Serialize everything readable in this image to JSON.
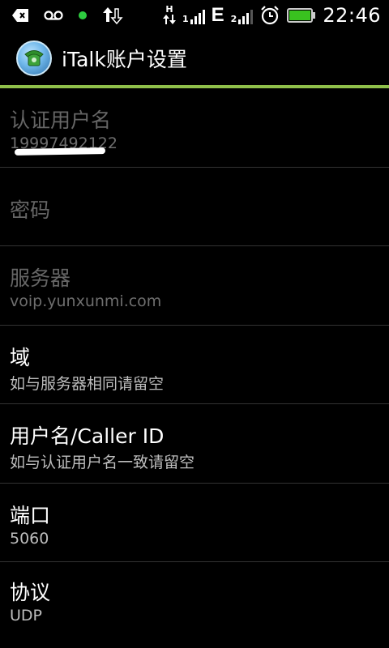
{
  "status_bar": {
    "time": "22:46",
    "network_label": "H",
    "sim2_label": "2",
    "sim1_label": "1",
    "e_label": "E",
    "icons": [
      "back-key-icon",
      "voicemail-icon",
      "green-dot-icon",
      "data-transfer-icon",
      "signal-h-icon",
      "signal-e-icon",
      "alarm-icon",
      "battery-icon"
    ],
    "battery_color": "#39c21f"
  },
  "header": {
    "title": "iTalk账户设置",
    "accent_color": "#8fbf4a"
  },
  "settings": [
    {
      "label": "认证用户名",
      "value": "19997492122",
      "enabled": false,
      "obscured": true
    },
    {
      "label": "密码",
      "value": "",
      "enabled": false
    },
    {
      "label": "服务器",
      "value": "voip.yunxunmi.com",
      "enabled": false
    },
    {
      "label": "域",
      "value": "如与服务器相同请留空",
      "enabled": true
    },
    {
      "label": "用户名/Caller ID",
      "value": "如与认证用户名一致请留空",
      "enabled": true
    },
    {
      "label": "端口",
      "value": "5060",
      "enabled": true
    },
    {
      "label": "协议",
      "value": "UDP",
      "enabled": true
    }
  ]
}
